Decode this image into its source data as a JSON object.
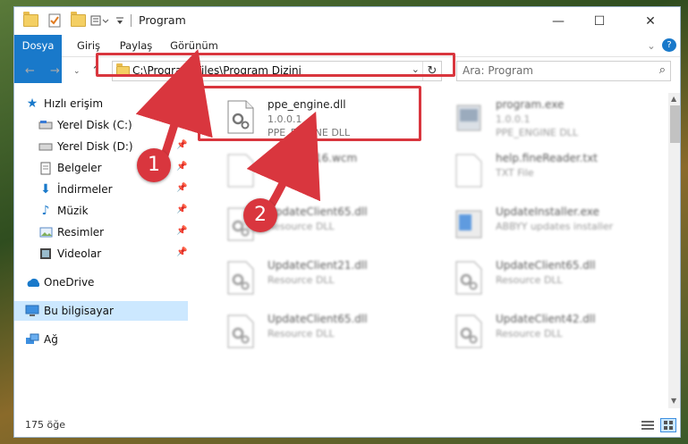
{
  "window": {
    "title": "Program",
    "controls": {
      "minimize": "—",
      "maximize": "☐",
      "close": "✕"
    }
  },
  "ribbon": {
    "tabs": [
      {
        "label": "Dosya",
        "active": true
      },
      {
        "label": "Giriş"
      },
      {
        "label": "Paylaş"
      },
      {
        "label": "Görünüm"
      }
    ],
    "help": "?"
  },
  "nav": {
    "address": "C:\\Program Files\\Program Dizini",
    "search_placeholder": "Ara: Program"
  },
  "sidebar": {
    "items": [
      {
        "label": "Hızlı erişim",
        "icon": "star-icon",
        "pinned": false
      },
      {
        "label": "Yerel Disk (C:)",
        "icon": "drive-icon",
        "pinned": true
      },
      {
        "label": "Yerel Disk (D:)",
        "icon": "drive-icon",
        "pinned": true
      },
      {
        "label": "Belgeler",
        "icon": "documents-icon",
        "pinned": true
      },
      {
        "label": "İndirmeler",
        "icon": "download-icon",
        "pinned": true
      },
      {
        "label": "Müzik",
        "icon": "music-icon",
        "pinned": true
      },
      {
        "label": "Resimler",
        "icon": "pictures-icon",
        "pinned": true
      },
      {
        "label": "Videolar",
        "icon": "videos-icon",
        "pinned": true
      },
      {
        "label": "OneDrive",
        "icon": "onedrive-icon"
      },
      {
        "label": "Bu bilgisayar",
        "icon": "computer-icon",
        "selected": true
      },
      {
        "label": "Ağ",
        "icon": "network-icon"
      }
    ]
  },
  "files": [
    {
      "name": "ppe_engine.dll",
      "line2": "1.0.0.1",
      "line3": "PPE_ENGINE DLL",
      "highlighted": true
    },
    {
      "name": "program.exe",
      "line2": "1.0.0.1",
      "line3": "PPE_ENGINE DLL"
    },
    {
      "name": "Sndb... P16.wcm",
      "line2": "WCM File",
      "line3": ""
    },
    {
      "name": "help.fineReader.txt",
      "line2": "TXT File",
      "line3": ""
    },
    {
      "name": "UpdateClient65.dll",
      "line2": "Resource DLL",
      "line3": ""
    },
    {
      "name": "UpdateInstaller.exe",
      "line2": "ABBYY updates installer",
      "line3": ""
    },
    {
      "name": "UpdateClient21.dll",
      "line2": "Resource DLL",
      "line3": ""
    },
    {
      "name": "UpdateClient65.dll",
      "line2": "Resource DLL",
      "line3": ""
    },
    {
      "name": "UpdateClient65.dll",
      "line2": "Resource DLL",
      "line3": ""
    },
    {
      "name": "UpdateClient42.dll",
      "line2": "Resource DLL",
      "line3": ""
    }
  ],
  "status": {
    "count": "175 öğe"
  },
  "annotations": {
    "step1": "1",
    "step2": "2",
    "color": "#d9363e"
  }
}
